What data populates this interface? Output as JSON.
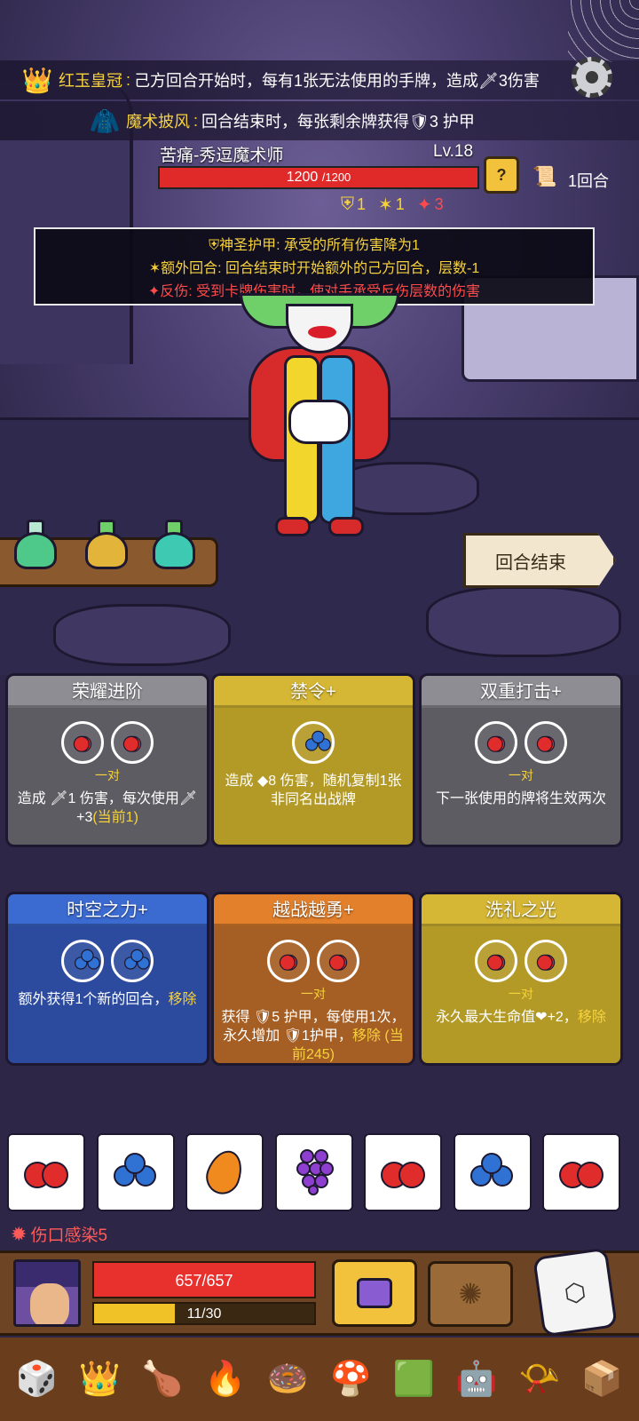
{
  "relics_top": [
    {
      "icon": "crown-icon",
      "glyph": "👑",
      "name": "红玉皇冠",
      "sep": ":",
      "desc": "己方回合开始时，每有1张无法使用的手牌，造成🗡3伤害"
    },
    {
      "icon": "cape-icon",
      "glyph": "🧥",
      "name": "魔术披风",
      "sep": ":",
      "desc": "回合结束时，每张剩余牌获得🛡3 护甲"
    }
  ],
  "enemy": {
    "name": "苦痛-秀逗魔术师",
    "level": "Lv.18",
    "hp": "1200",
    "hp_max": "/1200",
    "hp_ratio": 1.0,
    "buffs": [
      {
        "icon": "holy-armor-icon",
        "glyph": "⛨",
        "value": "1",
        "color": "#f6d23e"
      },
      {
        "icon": "extra-turn-icon",
        "glyph": "✶",
        "value": "1",
        "color": "#f6d23e"
      },
      {
        "icon": "thorns-icon",
        "glyph": "✦",
        "value": "3",
        "color": "#ff4a4a"
      }
    ]
  },
  "turn": {
    "label": "1回合"
  },
  "tooltip": [
    {
      "glyph": "⛨",
      "name": "神圣护甲",
      "desc": ": 承受的所有伤害降为1",
      "style": "gold"
    },
    {
      "glyph": "✶",
      "name": "额外回合",
      "desc": ": 回合结束时开始额外的己方回合，层数-1",
      "style": "gold"
    },
    {
      "glyph": "✦",
      "name": "反伤",
      "desc": ": 受到卡牌伤害时，使对手承受反伤层数的伤害",
      "style": "red"
    }
  ],
  "end_turn_label": "回合结束",
  "cards": [
    {
      "title": "荣耀进阶",
      "theme": "gray",
      "slots": [
        "cherry",
        "cherry"
      ],
      "pair": "一对",
      "desc": "造成 🗡1 伤害，每次使用🗡+3",
      "note": "(当前1)"
    },
    {
      "title": "禁令+",
      "theme": "gold",
      "slots": [
        "blueberry"
      ],
      "pair": "",
      "desc": "造成 ◆8 伤害，随机复制1张非同名出战牌",
      "note": ""
    },
    {
      "title": "双重打击+",
      "theme": "gray",
      "slots": [
        "cherry",
        "cherry"
      ],
      "pair": "一对",
      "desc": "下一张使用的牌将生效两次",
      "note": ""
    },
    {
      "title": "时空之力+",
      "theme": "blue",
      "slots": [
        "blueberry",
        "blueberry"
      ],
      "pair": "",
      "desc": "额外获得1个新的回合，",
      "note": "移除"
    },
    {
      "title": "越战越勇+",
      "theme": "orange",
      "slots": [
        "cherry",
        "cherry"
      ],
      "pair": "一对",
      "desc": "获得 🛡5 护甲，每使用1次，永久增加 🛡1护甲，",
      "note": "移除 (当前245)"
    },
    {
      "title": "洗礼之光",
      "theme": "gold",
      "slots": [
        "cherry",
        "cherry"
      ],
      "pair": "一对",
      "desc": "永久最大生命值❤+2，",
      "note": "移除"
    }
  ],
  "dice": [
    "cherry",
    "blueberry",
    "orange",
    "grape",
    "cherry",
    "blueberry",
    "cherry"
  ],
  "status": {
    "glyph": "✹",
    "label": "伤口感染5"
  },
  "player": {
    "hp": "657/657",
    "hp_ratio": 1.0,
    "energy": "11/30",
    "energy_ratio": 0.3667
  },
  "relic_bar": [
    {
      "name": "spiked-die-icon",
      "glyph": "🎲"
    },
    {
      "name": "crown-icon",
      "glyph": "👑"
    },
    {
      "name": "meat-icon",
      "glyph": "🍗"
    },
    {
      "name": "flame-crown-icon",
      "glyph": "🔥"
    },
    {
      "name": "donut-icon",
      "glyph": "🍩"
    },
    {
      "name": "mushroom-icon",
      "glyph": "🍄"
    },
    {
      "name": "slime-icon",
      "glyph": "🟩"
    },
    {
      "name": "robot-icon",
      "glyph": "🤖"
    },
    {
      "name": "horn-icon",
      "glyph": "📯"
    },
    {
      "name": "chest-icon",
      "glyph": "📦"
    }
  ]
}
